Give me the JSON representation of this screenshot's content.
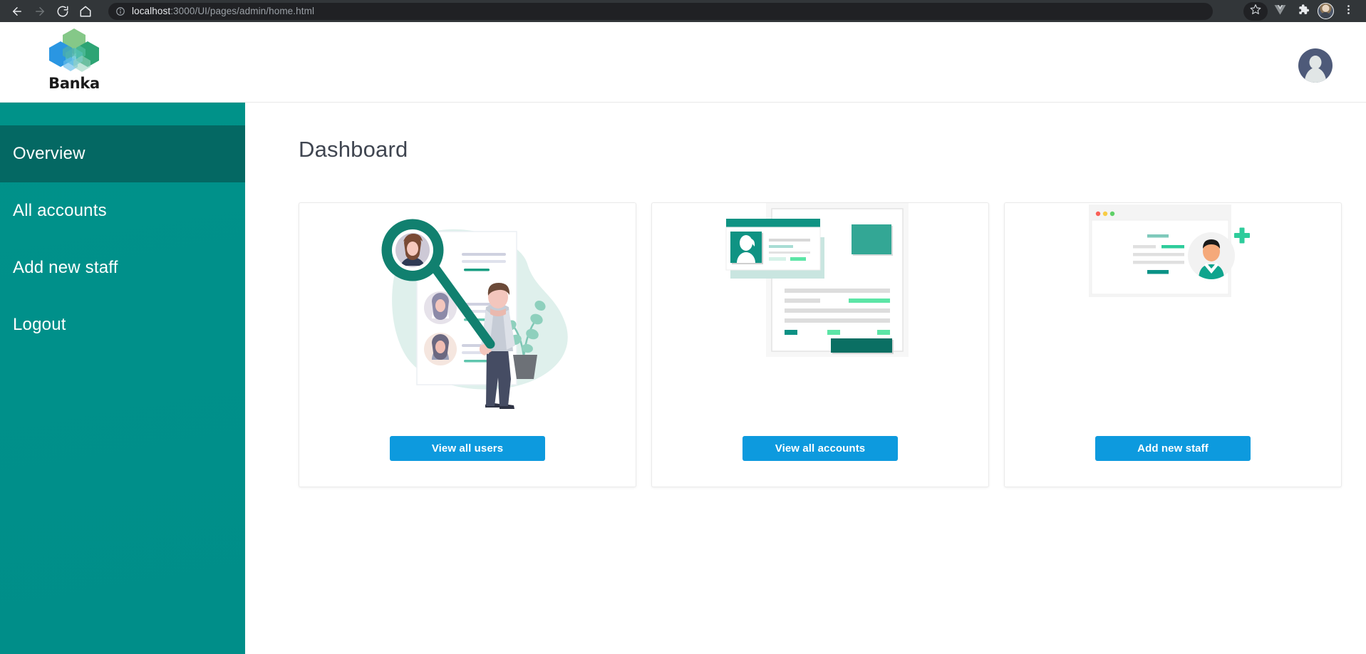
{
  "browser": {
    "back_icon": "back-arrow-icon",
    "forward_icon": "forward-arrow-icon",
    "reload_icon": "reload-icon",
    "home_icon": "home-icon",
    "site_info_icon": "site-info-icon",
    "url_host": "localhost",
    "url_path": ":3000/UI/pages/admin/home.html",
    "url_full": "localhost:3000/UI/pages/admin/home.html",
    "bookmark_icon": "star-icon",
    "vue_devtools_icon": "vue-devtools-icon",
    "extensions_icon": "puzzle-piece-icon",
    "profile_icon": "browser-profile-avatar",
    "menu_icon": "three-dot-menu-icon"
  },
  "header": {
    "logo_name": "banka-logo-icon",
    "brand": "Banka",
    "avatar_icon": "user-avatar-icon"
  },
  "sidebar": {
    "items": [
      {
        "label": "Overview",
        "active": true
      },
      {
        "label": "All accounts",
        "active": false
      },
      {
        "label": "Add new staff",
        "active": false
      },
      {
        "label": "Logout",
        "active": false
      }
    ]
  },
  "main": {
    "title": "Dashboard",
    "cards": [
      {
        "illustration": "user-search-illustration",
        "button_label": "View all users"
      },
      {
        "illustration": "accounts-document-illustration",
        "button_label": "View all accounts"
      },
      {
        "illustration": "add-staff-window-illustration",
        "button_label": "Add new staff"
      }
    ]
  },
  "colors": {
    "sidebar_teal": "#00908a",
    "sidebar_active": "#046863",
    "button_blue": "#0d9ade",
    "accent_green": "#14a085",
    "chrome_dark": "#323639",
    "omnibox_dark": "#202124"
  }
}
